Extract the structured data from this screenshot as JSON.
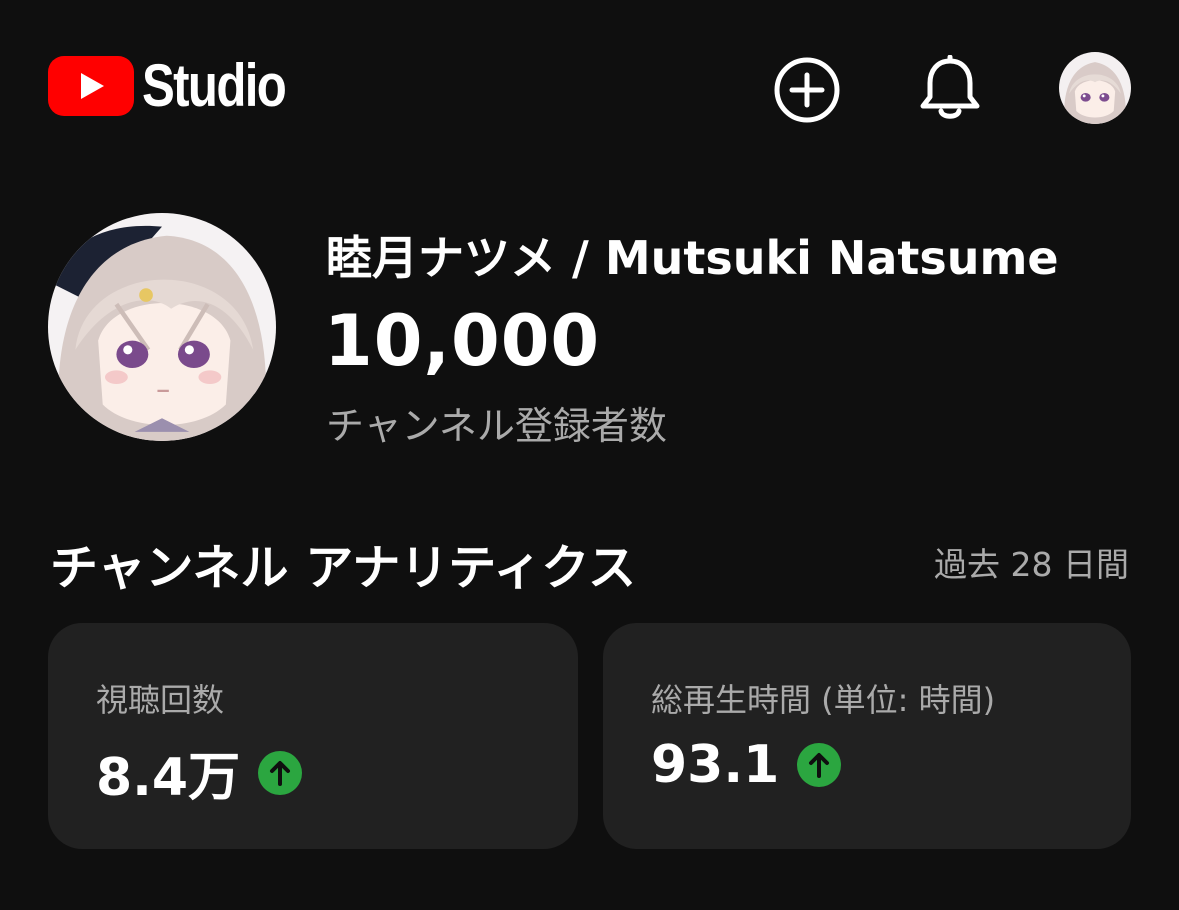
{
  "header": {
    "logo_text": "Studio",
    "create_icon": "add-circle-icon",
    "notifications_icon": "bell-icon",
    "account_avatar": "account-avatar"
  },
  "channel": {
    "name": "睦月ナツメ / Mutsuki Natsume",
    "subscriber_count": "10,000",
    "subscriber_label": "チャンネル登録者数"
  },
  "analytics": {
    "title": "チャンネル アナリティクス",
    "period": "過去 28 日間",
    "cards": [
      {
        "label": "視聴回数",
        "value": "8.4万",
        "trend": "up"
      },
      {
        "label": "総再生時間 (単位: 時間)",
        "value": "93.1",
        "trend": "up"
      }
    ]
  },
  "colors": {
    "background": "#0f0f0f",
    "card": "#212121",
    "brand_red": "#ff0000",
    "trend_up": "#2ba640"
  }
}
